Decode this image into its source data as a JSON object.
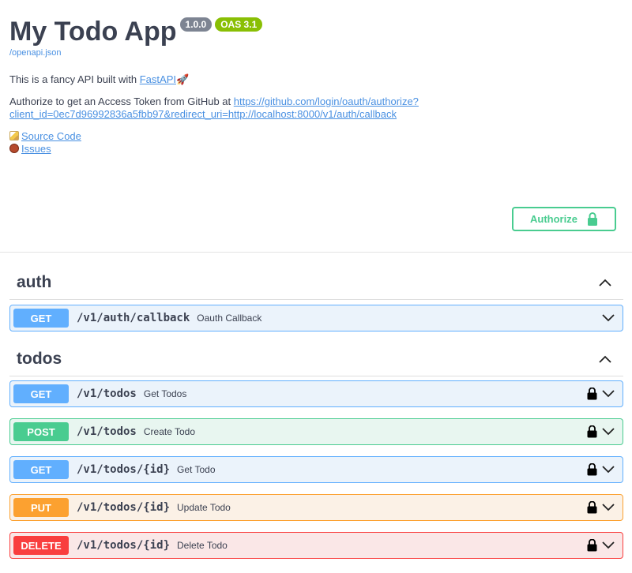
{
  "info": {
    "title": "My Todo App",
    "version": "1.0.0",
    "oas": "OAS 3.1",
    "spec_link": "/openapi.json",
    "desc_prefix": "This is a fancy API built with ",
    "fastapi_link": "FastAPI",
    "rocket": "🚀",
    "auth_text": "Authorize to get an Access Token from GitHub at ",
    "auth_url": "https://github.com/login/oauth/authorize?client_id=0ec7d96992836a5fbb97&redirect_uri=http://localhost:8000/v1/auth/callback",
    "source_code": "Source Code",
    "issues": "Issues"
  },
  "authorize": {
    "label": "Authorize"
  },
  "tags": [
    {
      "name": "auth",
      "operations": [
        {
          "method": "GET",
          "path": "/v1/auth/callback",
          "summary": "Oauth Callback",
          "locked": false
        }
      ]
    },
    {
      "name": "todos",
      "operations": [
        {
          "method": "GET",
          "path": "/v1/todos",
          "summary": "Get Todos",
          "locked": true
        },
        {
          "method": "POST",
          "path": "/v1/todos",
          "summary": "Create Todo",
          "locked": true
        },
        {
          "method": "GET",
          "path": "/v1/todos/{id}",
          "summary": "Get Todo",
          "locked": true
        },
        {
          "method": "PUT",
          "path": "/v1/todos/{id}",
          "summary": "Update Todo",
          "locked": true
        },
        {
          "method": "DELETE",
          "path": "/v1/todos/{id}",
          "summary": "Delete Todo",
          "locked": true
        }
      ]
    }
  ],
  "colors": {
    "get": "#61affe",
    "post": "#49cc90",
    "put": "#fca130",
    "delete": "#f93e3e",
    "link": "#4990e2"
  },
  "icons": {
    "lock": "lock-icon",
    "expand": "chevron-down-icon",
    "collapse": "chevron-up-icon",
    "pencil": "memo-icon",
    "bug": "bug-icon"
  }
}
